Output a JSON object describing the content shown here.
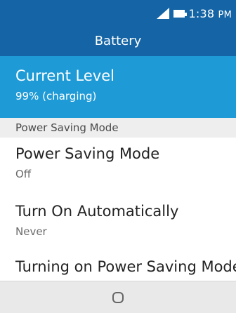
{
  "status_bar": {
    "time": "1:38",
    "ampm": "PM",
    "icons": [
      "signal-icon",
      "battery-icon"
    ]
  },
  "header": {
    "title": "Battery"
  },
  "current_level": {
    "label": "Current Level",
    "value": "99% (charging)"
  },
  "section": {
    "title": "Power Saving Mode"
  },
  "items": [
    {
      "label": "Power Saving Mode",
      "value": "Off"
    },
    {
      "label": "Turn On Automatically",
      "value": "Never"
    },
    {
      "label": "Turning on Power Saving Mode will turn off the"
    }
  ],
  "softkey": {
    "icon": "center-softkey-icon"
  },
  "colors": {
    "header_bg": "#1565a6",
    "selected_bg": "#1e9ad6",
    "section_bg": "#eeeeee",
    "softkey_bg": "#e9e9e9"
  }
}
